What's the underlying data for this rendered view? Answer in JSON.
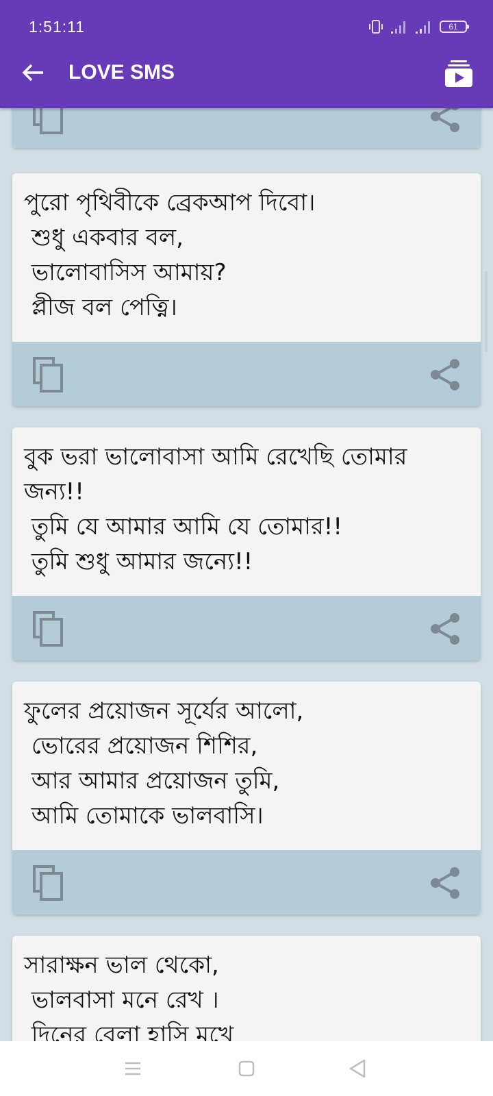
{
  "status_bar": {
    "time": "1:51:11",
    "battery": "61"
  },
  "toolbar": {
    "title": "LOVE SMS",
    "back_icon": "arrow-left-icon",
    "action_icon": "video-playlist-icon"
  },
  "colors": {
    "primary": "#673ab7",
    "background": "#d1dee6",
    "card_text_bg": "#f4f4f4",
    "card_action_bg": "#b4cbd8",
    "icon_gray": "#7d8a93"
  },
  "messages": [
    {
      "text": ""
    },
    {
      "text": "পুরো পৃথিবীকে ব্রেকআপ দিবো।\n শুধু একবার বল,\n ভালোবাসিস আমায়?\n প্লীজ বল পেত্নি।"
    },
    {
      "text": "বুক ভরা ভালোবাসা আমি রেখেছি তোমার জন্য!!\n তুমি যে আমার আমি যে তোমার!!\n তুমি শুধু আমার জন্যে!!"
    },
    {
      "text": "ফুলের প্রয়োজন সূর্যের আলো,\n ভোরের প্রয়োজন শিশির,\n আর আমার প্রয়োজন তুমি,\n আমি তোমাকে ভালবাসি।"
    },
    {
      "text": "সারাক্ষন ভাল থেকো,\n ভালবাসা মনে রেখ ।\n দিনের বেলা হাসি মুখে"
    }
  ],
  "card_actions": {
    "copy_icon": "copy-icon",
    "share_icon": "share-icon"
  },
  "nav_bar": {
    "menu_icon": "recent-apps-icon",
    "home_icon": "home-icon",
    "back_icon": "back-triangle-icon"
  }
}
